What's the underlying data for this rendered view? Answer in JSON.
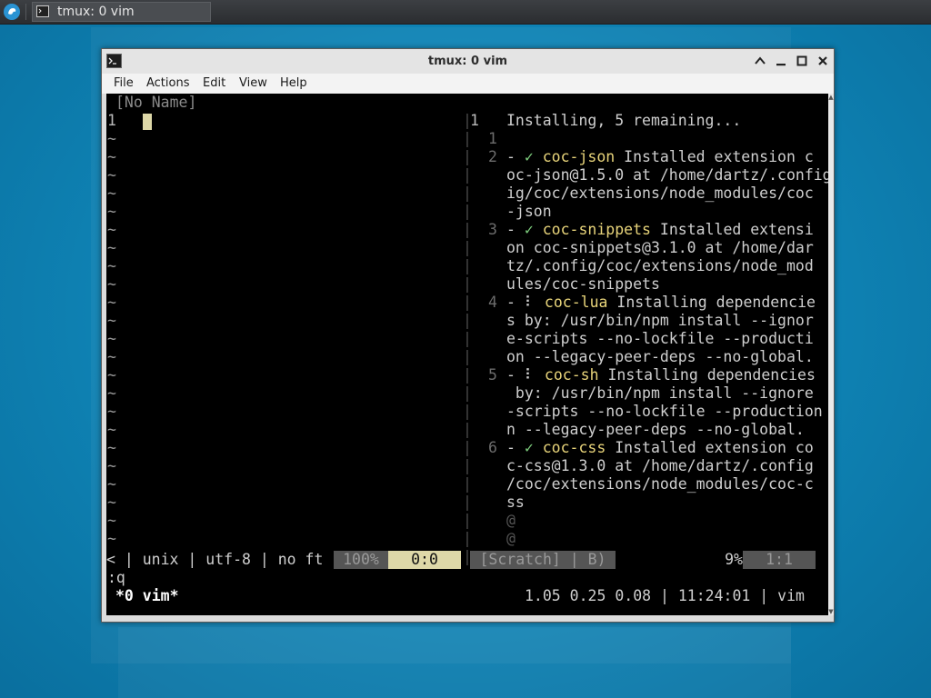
{
  "colors": {
    "desktop": "#0f86b8",
    "terminal_bg": "#000000",
    "status_bg": "#555555",
    "cursor": "#ded8a8",
    "check": "#7fd07f",
    "ext_name": "#e8d47a"
  },
  "taskbar": {
    "start_icon": "system-menu-icon",
    "task_label": "tmux: 0 vim"
  },
  "window": {
    "title": "tmux: 0 vim",
    "icon": "terminal-icon",
    "buttons": [
      "minimize-up",
      "minimize",
      "maximize",
      "close"
    ]
  },
  "menu": [
    "File",
    "Actions",
    "Edit",
    "View",
    "Help"
  ],
  "vim": {
    "buffer_title": "[No Name]",
    "first_line_number": "1",
    "tilde": "~",
    "cmdline": ":q"
  },
  "coc": {
    "pane_line": "1",
    "header": "Installing, 5 remaining...",
    "rows": [
      {
        "num": "1",
        "text": ""
      },
      {
        "num": "2",
        "text": ""
      },
      {
        "num": "",
        "text": "oc-json@1.5.0 at /home/dartz/.config"
      },
      {
        "num": "",
        "text": "ig/coc/extensions/node_modules/coc"
      },
      {
        "num": "",
        "text": "-json"
      },
      {
        "num": "3",
        "text": ""
      },
      {
        "num": "",
        "text": "on coc-snippets@3.1.0 at /home/dar"
      },
      {
        "num": "",
        "text": "tz/.config/coc/extensions/node_mod"
      },
      {
        "num": "",
        "text": "ules/coc-snippets"
      },
      {
        "num": "4",
        "text": ""
      },
      {
        "num": "",
        "text": "s by: /usr/bin/npm install --ignor"
      },
      {
        "num": "",
        "text": "e-scripts --no-lockfile --producti"
      },
      {
        "num": "",
        "text": "on --legacy-peer-deps --no-global."
      },
      {
        "num": "5",
        "text": ""
      },
      {
        "num": "",
        "text": " by: /usr/bin/npm install --ignore"
      },
      {
        "num": "",
        "text": "-scripts --no-lockfile --production"
      },
      {
        "num": "",
        "text": "n --legacy-peer-deps --no-global."
      },
      {
        "num": "6",
        "text": ""
      },
      {
        "num": "",
        "text": "c-css@1.3.0 at /home/dartz/.config"
      },
      {
        "num": "",
        "text": "/coc/extensions/node_modules/coc-c"
      },
      {
        "num": "",
        "text": "ss"
      },
      {
        "num": "",
        "text": "@"
      },
      {
        "num": "",
        "text": "@"
      }
    ],
    "items": [
      {
        "prefix": "- ",
        "mark": "✓",
        "name": "coc-json",
        "rest": " Installed extension c"
      },
      {
        "prefix": "- ",
        "mark": "✓",
        "name": "coc-snippets",
        "rest": " Installed extensi"
      },
      {
        "prefix": "- ",
        "mark": "⠇",
        "name": "coc-lua",
        "rest": " Installing dependencie"
      },
      {
        "prefix": "- ",
        "mark": "⠇",
        "name": "coc-sh",
        "rest": " Installing dependencies"
      },
      {
        "prefix": "- ",
        "mark": "✓",
        "name": "coc-css",
        "rest": " Installed extension co"
      }
    ]
  },
  "statusline": {
    "left": "< | unix | utf-8 | no ft ",
    "percent": "100%",
    "position": "0:0",
    "scratch": "[Scratch] | B)",
    "right_percent": "9%",
    "right_pos": "1:1"
  },
  "tmux": {
    "window_label": "*0 vim*",
    "right_status": "1.05 0.25 0.08 | 11:24:01 | vim"
  }
}
